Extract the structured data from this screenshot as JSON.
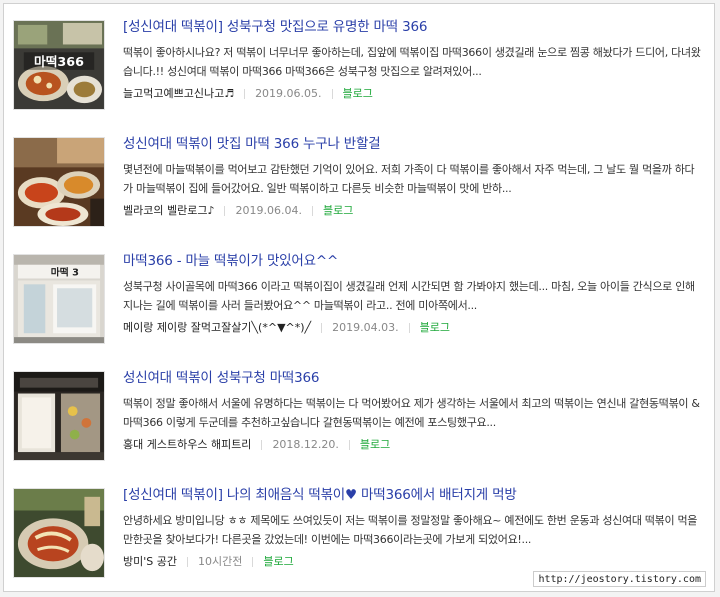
{
  "results": [
    {
      "title": "[성신여대 떡볶이] 성북구청 맛집으로 유명한 마떡 366",
      "snippet": "떡볶이 좋아하시나요? 저 떡볶이 너무너무 좋아하는데, 집앞에 떡볶이집 마떡366이 생겼길래 눈으로 찜콩 해놨다가 드디어, 다녀왔습니다.!! 성신여대 떡볶이 마떡366 마떡366은 성북구청 맛집으로 알려져있어...",
      "author": "늘고먹고예쁘고신나고♬",
      "date": "2019.06.05.",
      "blog": "블로그",
      "thumb_text": "마떡366"
    },
    {
      "title": "성신여대 떡볶이 맛집 마떡 366 누구나 반할걸",
      "snippet": "몇년전에 마늘떡볶이를 먹어보고 감탄했던 기억이 있어요. 저희 가족이 다 떡볶이를 좋아해서 자주 먹는데, 그 날도 뭘 먹을까 하다가 마늘떡볶이 집에 들어갔어요. 일반 떡볶이하고 다른듯 비슷한 마늘떡볶이 맛에 반하...",
      "author": "벨라코의 벨란로그♪",
      "date": "2019.06.04.",
      "blog": "블로그",
      "thumb_text": ""
    },
    {
      "title": "마떡366 - 마늘 떡볶이가 맛있어요^^",
      "snippet": "성북구청 사이골목에 마떡366 이라고 떡볶이집이 생겼길래 언제 시간되면 함 가봐야지 했는데... 마침, 오늘 아이들 간식으로 인해 지나는 길에 떡볶이를 사러 들러봤어요^^ 마늘떡볶이 라고.. 전에 미아쪽에서...",
      "author": "메이랑 제이랑 잘먹고잘살기╲(*^▼^*)╱",
      "date": "2019.04.03.",
      "blog": "블로그",
      "thumb_text": "마떡 3"
    },
    {
      "title": "성신여대 떡볶이 성북구청 마떡366",
      "snippet": "떡볶이 정말 좋아해서 서울에 유명하다는 떡볶이는 다 먹어봤어요 제가 생각하는 서울에서 최고의 떡볶이는 연신내 갈현동떡볶이 & 마떡366 이렇게 두군데를 추천하고싶습니다 갈현동떡볶이는 예전에 포스팅했구요...",
      "author": "홍대 게스트하우스 해피트리",
      "date": "2018.12.20.",
      "blog": "블로그",
      "thumb_text": ""
    },
    {
      "title": "[성신여대 떡볶이] 나의 최애음식 떡볶이♥ 마떡366에서 배터지게 먹방",
      "snippet": "안녕하세요 방미입니당 ㅎㅎ 제목에도 쓰여있듯이 저는 떡볶이를 정말정말 좋아해요~ 예전에도 한번 운동과 성신여대 떡볶이 먹을 만한곳을 찾아보다가! 다른곳을 갔었는데! 이번에는 마떡366이라는곳에 가보게 되었어요!...",
      "author": "방미'S 공간",
      "date": "10시간전",
      "blog": "블로그",
      "thumb_text": ""
    }
  ],
  "watermark": "http://jeostory.tistory.com",
  "colors": {
    "title": "#2a3fa8",
    "blog_link": "#1ea83a",
    "date": "#888888",
    "text": "#333333"
  }
}
